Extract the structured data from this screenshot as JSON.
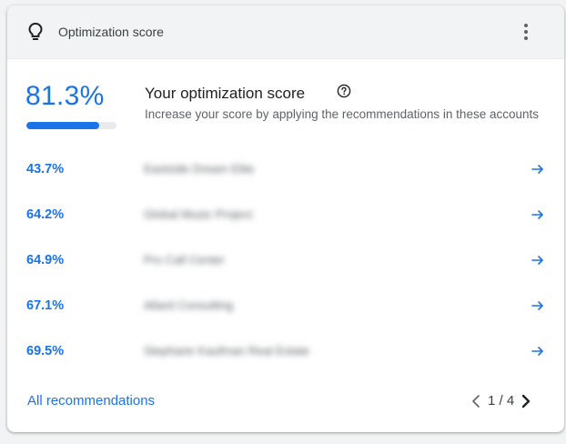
{
  "header": {
    "title": "Optimization score",
    "icon": "lightbulb-icon",
    "menu_icon": "more-vert-icon"
  },
  "summary": {
    "score": "81.3%",
    "score_fraction": 0.813,
    "title": "Your optimization score",
    "help_icon": "help-icon",
    "description": "Increase your score by applying the recommendations in these accounts"
  },
  "accounts": [
    {
      "score": "43.7%",
      "name": "Eastside Dream Elite"
    },
    {
      "score": "64.2%",
      "name": "Global Music Project"
    },
    {
      "score": "64.9%",
      "name": "Pro Call Center"
    },
    {
      "score": "67.1%",
      "name": "Allard Consulting"
    },
    {
      "score": "69.5%",
      "name": "Stephane Kaufman Real Estate"
    }
  ],
  "footer": {
    "all_recommendations": "All recommendations",
    "page_indicator": "1 / 4"
  },
  "colors": {
    "accent": "#1a73e8",
    "header_bg": "#f1f3f4",
    "track": "#e8eaed"
  }
}
